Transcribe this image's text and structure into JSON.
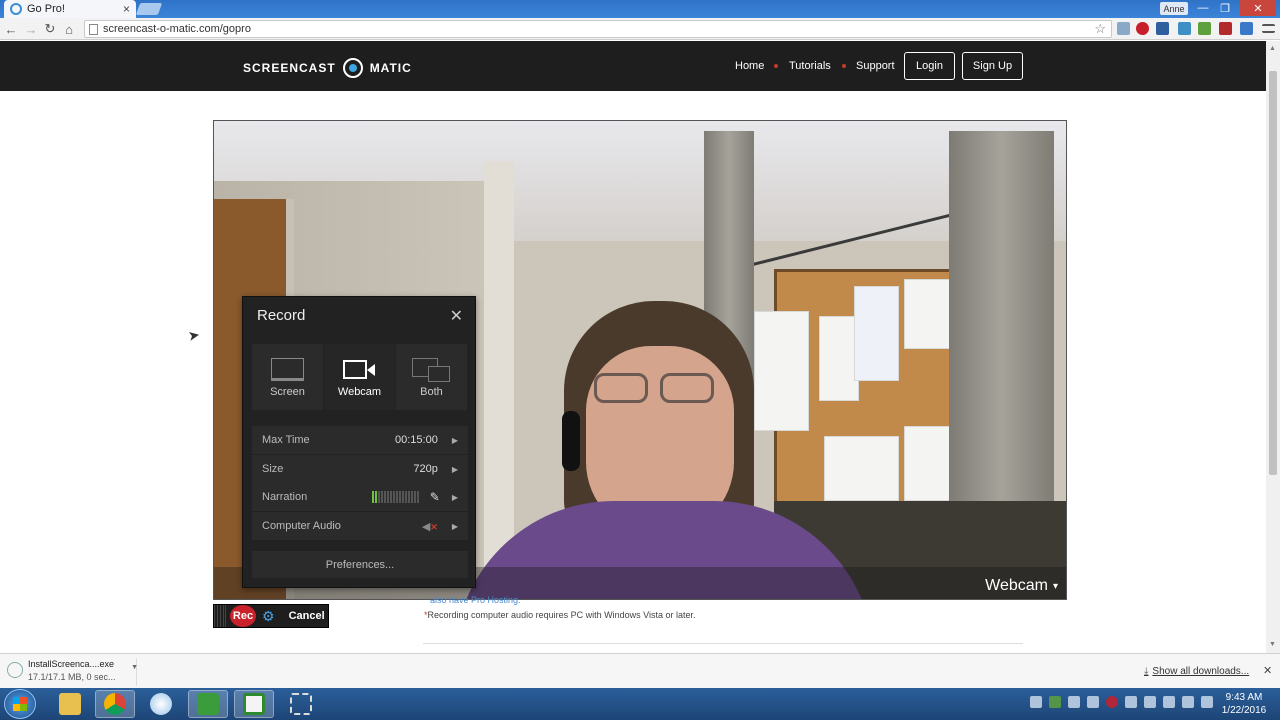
{
  "browser": {
    "tab_title": "Go Pro!",
    "tab_close": "×",
    "user_label": "Anne",
    "url": "screencast-o-matic.com/gopro",
    "nav": {
      "back": "←",
      "forward": "→",
      "reload": "↻",
      "home": "⌂"
    },
    "star": "☆",
    "window_controls": {
      "minimize": "—",
      "maximize": "❐",
      "close": "✕"
    }
  },
  "site": {
    "logo_left": "SCREENCAST",
    "logo_right": "MATIC",
    "nav": {
      "home": "Home",
      "tutorials": "Tutorials",
      "support": "Support",
      "login": "Login",
      "signup": "Sign Up"
    },
    "accent_color": "#c23b2b",
    "brand_blue": "#3ea6e0"
  },
  "webcam": {
    "label": "Webcam",
    "caret": "▾"
  },
  "record_panel": {
    "title": "Record",
    "close": "✕",
    "modes": [
      {
        "label": "Screen",
        "icon": "screen-icon",
        "active": false
      },
      {
        "label": "Webcam",
        "icon": "webcam-icon",
        "active": true
      },
      {
        "label": "Both",
        "icon": "both-icon",
        "active": false
      }
    ],
    "options": {
      "max_time_label": "Max Time",
      "max_time_value": "00:15:00",
      "size_label": "Size",
      "size_value": "720p",
      "narration_label": "Narration",
      "narration_level": 0.15,
      "computer_audio_label": "Computer Audio"
    },
    "arrow": "▶",
    "preferences": "Preferences..."
  },
  "rec_bar": {
    "rec": "Rec",
    "gear": "⚙",
    "cancel": "Cancel"
  },
  "notes": {
    "pro_hosting": "also have Pro Hosting.",
    "audio_marker": "*",
    "audio_note": "Recording computer audio requires PC with Windows Vista or later."
  },
  "downloads": {
    "file_name": "InstallScreenca....exe",
    "file_meta": "17.1/17.1 MB, 0 sec...",
    "show_all": "Show all downloads...",
    "close": "✕"
  },
  "taskbar": {
    "time": "9:43 AM",
    "date": "1/22/2016",
    "apps": [
      "folder-icon",
      "chrome-icon",
      "itunes-icon",
      "camtasia-icon",
      "camtasia-recorder-icon",
      "snipping-icon"
    ]
  }
}
